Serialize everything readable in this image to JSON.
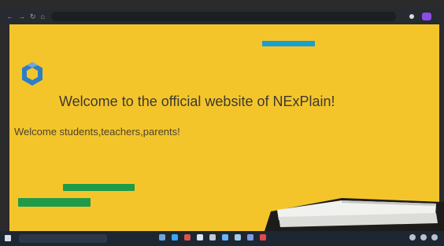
{
  "browser": {
    "address": "",
    "profile_color": "#8a4de6"
  },
  "page": {
    "top_link_label": "",
    "hero_title": "Welcome to the official website of NExPlain!",
    "subtitle": "Welcome students,teachers,parents!",
    "question": "",
    "button_primary_label": "",
    "button_secondary_label": "",
    "background_color": "#f3c52b",
    "logo_color": "#2f7ec4",
    "button_color": "#1f9a49",
    "top_button_color": "#1a9fd1"
  },
  "taskbar": {
    "search_placeholder": ""
  }
}
